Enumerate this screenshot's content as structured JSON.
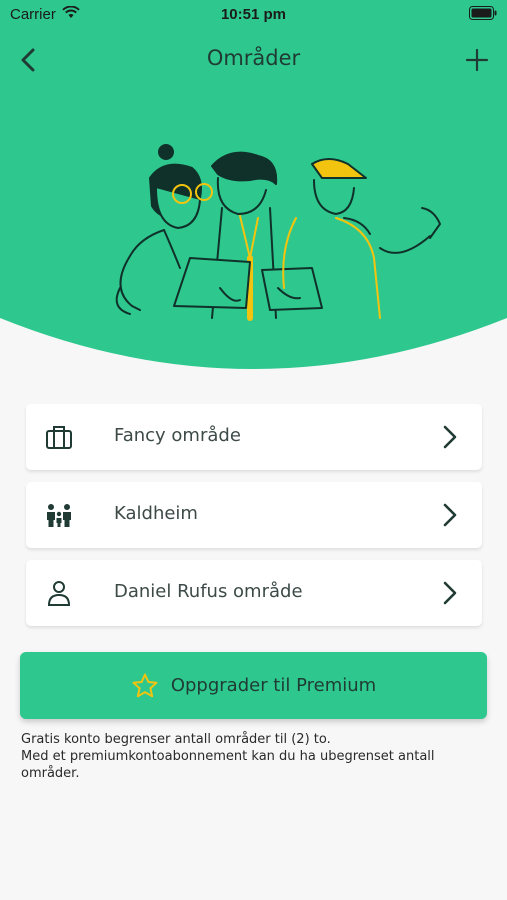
{
  "status_bar": {
    "carrier": "Carrier",
    "time": "10:51 pm"
  },
  "nav": {
    "title": "Områder",
    "back_icon": "chevron-left-icon",
    "add_icon": "plus-icon"
  },
  "colors": {
    "brand_green": "#2ec88f",
    "dark_text": "#1f3b34",
    "accent_yellow": "#f2c40f"
  },
  "areas": [
    {
      "label": "Fancy område",
      "icon": "briefcase-icon"
    },
    {
      "label": "Kaldheim",
      "icon": "family-icon"
    },
    {
      "label": "Daniel Rufus område",
      "icon": "person-icon"
    }
  ],
  "premium": {
    "label": "Oppgrader til Premium",
    "icon": "star-icon"
  },
  "info": {
    "line1": "Gratis konto begrenser antall områder til (2) to.",
    "line2": "Med et premiumkontoabonnement kan du ha ubegrenset antall områder."
  }
}
